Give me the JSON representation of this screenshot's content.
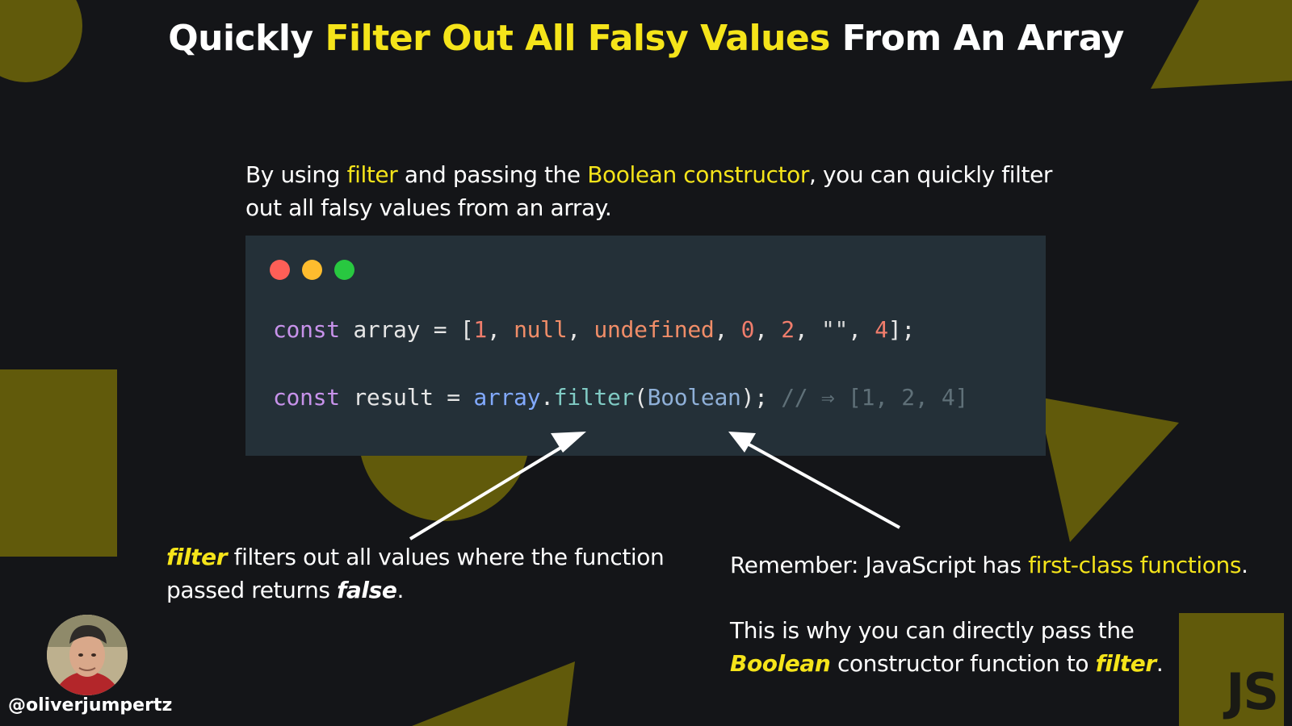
{
  "title": {
    "part1": "Quickly ",
    "highlight": "Filter Out All Falsy Values",
    "part2": " From An Array"
  },
  "intro": {
    "p1": "By using ",
    "h1": "filter",
    "p2": " and passing the ",
    "h2": "Boolean constructor",
    "p3": ", you can quickly filter out all falsy values from an array."
  },
  "code": {
    "line1": {
      "kw": "const",
      "sp1": " array = [",
      "n1": "1",
      "c1": ", ",
      "null": "null",
      "c2": ", ",
      "undef": "undefined",
      "c3": ", ",
      "n2": "0",
      "c4": ", ",
      "n3": "2",
      "c5": ", ",
      "str": "\"\"",
      "c6": ", ",
      "n4": "4",
      "end": "];"
    },
    "line2": {
      "kw": "const",
      "sp1": " result = ",
      "var": "array",
      "dot": ".",
      "fn": "filter",
      "open": "(",
      "cls": "Boolean",
      "close": ");",
      "comment": " // ⇒ [1, 2, 4]"
    }
  },
  "note_left": {
    "kw": "filter",
    "t1": " filters out all values where the function passed returns ",
    "kw2": "false",
    "t2": "."
  },
  "note_right": {
    "l1a": "Remember: JavaScript has ",
    "l1h": "first-class functions",
    "l1b": ".",
    "l2a": "This is why you can directly pass the ",
    "l2k1": "Boolean",
    "l2b": " constructor function to ",
    "l2k2": "filter",
    "l2c": "."
  },
  "author": {
    "handle": "@oliverjumpertz"
  },
  "logo": {
    "text": "JS"
  },
  "colors": {
    "background": "#141518",
    "accent": "#f5e41a",
    "shape": "#615a0b",
    "code_bg": "#243038"
  }
}
